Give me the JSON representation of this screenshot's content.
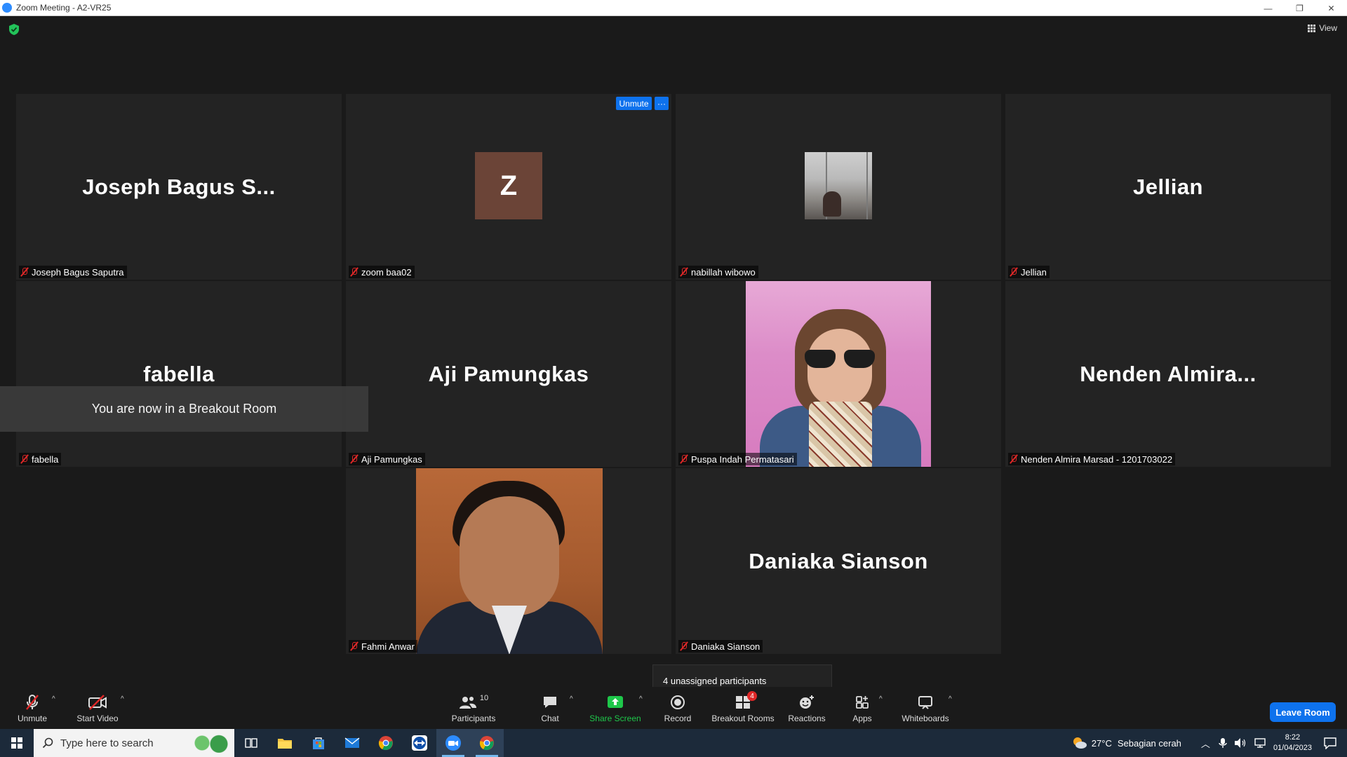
{
  "window": {
    "title": "Zoom Meeting - A2-VR25",
    "minimize": "—",
    "restore": "❐",
    "close": "✕"
  },
  "top": {
    "view_label": "View"
  },
  "tiles": [
    {
      "big": "Joseph  Bagus  S...",
      "label": "Joseph Bagus Saputra"
    },
    {
      "avatar_letter": "Z",
      "label": "zoom baa02",
      "unmute": "Unmute",
      "more": "···"
    },
    {
      "label": "nabillah wibowo"
    },
    {
      "big": "Jellian",
      "label": "Jellian"
    },
    {
      "big": "fabella",
      "label": "fabella"
    },
    {
      "big": "Aji  Pamungkas",
      "label": "Aji Pamungkas"
    },
    {
      "label": "Puspa Indah Permatasari"
    },
    {
      "big": "Nenden  Almira...",
      "label": "Nenden Almira Marsad - 1201703022"
    },
    {
      "label": "Fahmi Anwar"
    },
    {
      "big": "Daniaka  Sianson",
      "label": "Daniaka Sianson"
    }
  ],
  "toast": "You are now in a Breakout Room",
  "popup": "4 unassigned participants",
  "toolbar": {
    "unmute": "Unmute",
    "start_video": "Start Video",
    "participants": "Participants",
    "participants_count": "10",
    "chat": "Chat",
    "share_screen": "Share Screen",
    "record": "Record",
    "breakout_rooms": "Breakout Rooms",
    "breakout_badge": "4",
    "reactions": "Reactions",
    "apps": "Apps",
    "whiteboards": "Whiteboards",
    "leave": "Leave Room",
    "caret": "^"
  },
  "taskbar": {
    "search_placeholder": "Type here to search",
    "weather_temp": "27°C",
    "weather_text": "Sebagian cerah",
    "time": "8:22",
    "date": "01/04/2023"
  },
  "colors": {
    "accent": "#0e72ed",
    "share_green": "#1ec74a",
    "muted_red": "#e02828"
  }
}
